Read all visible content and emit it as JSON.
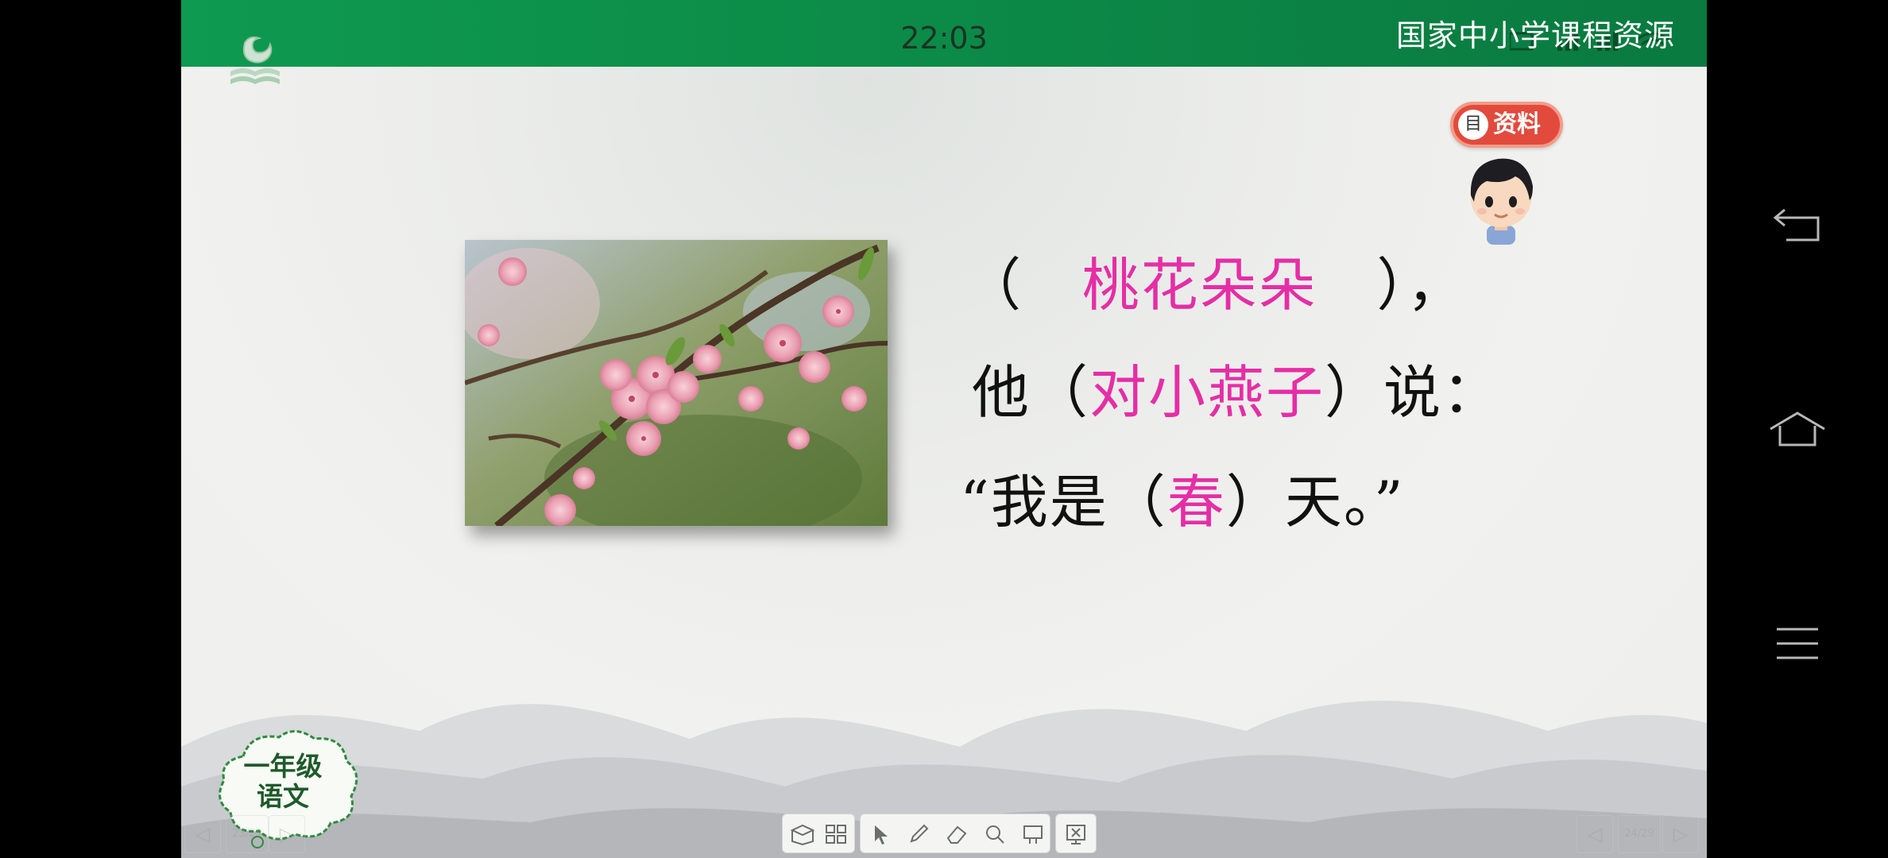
{
  "status": {
    "time": "22:03",
    "brand": "国家中小学课程资源"
  },
  "badge": {
    "icon": "document-icon",
    "doc_glyph": "目",
    "label": "资料"
  },
  "slide": {
    "line1": {
      "open": "（",
      "answer": "桃花朵朵",
      "close": "），"
    },
    "line2": {
      "prefix": "他（",
      "answer": "对小燕子",
      "suffix": "）说："
    },
    "line3": {
      "prefix": "“我是（",
      "answer": "春",
      "suffix": "）天。”"
    },
    "image": "peach-blossom-photo",
    "grade_line1": "一年级",
    "grade_line2": "语文"
  },
  "pager": {
    "left": "23/29",
    "right": "24/29"
  },
  "toolbar": {
    "items": [
      "book-icon",
      "grid-icon",
      "pointer-icon",
      "pen-icon",
      "eraser-icon",
      "search-icon",
      "screen-icon",
      "exit-presentation-icon"
    ]
  },
  "navbar": {
    "items": [
      "back-icon",
      "home-icon",
      "menu-icon"
    ]
  },
  "colors": {
    "topbar": "#0c8a47",
    "answer": "#e52ea6",
    "badge": "#e24a3c"
  }
}
